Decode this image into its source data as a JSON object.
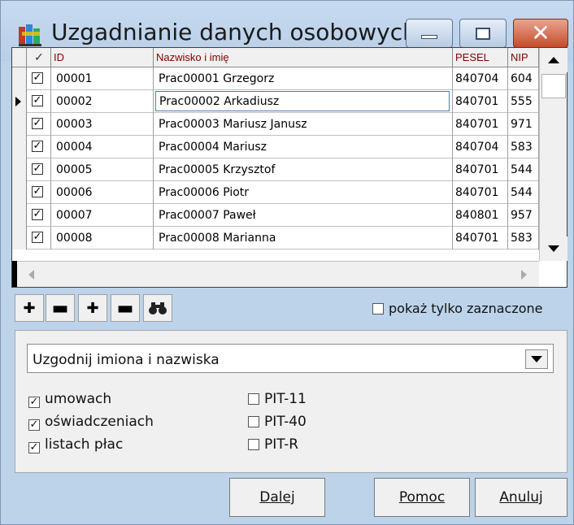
{
  "window": {
    "title": "Uzgadnianie danych osobowych"
  },
  "grid": {
    "columns": [
      "✓",
      "ID",
      "Nazwisko i imię",
      "PESEL",
      "NIP"
    ],
    "selected_row_index": 1,
    "rows": [
      {
        "checked": true,
        "id": "00001",
        "name": "Prac00001 Grzegorz",
        "pesel": "840704",
        "nip": "604"
      },
      {
        "checked": true,
        "id": "00002",
        "name": "Prac00002 Arkadiusz",
        "pesel": "840701",
        "nip": "555"
      },
      {
        "checked": true,
        "id": "00003",
        "name": "Prac00003 Mariusz Janusz",
        "pesel": "840701",
        "nip": "971"
      },
      {
        "checked": true,
        "id": "00004",
        "name": "Prac00004 Mariusz",
        "pesel": "840704",
        "nip": "583"
      },
      {
        "checked": true,
        "id": "00005",
        "name": "Prac00005 Krzysztof",
        "pesel": "840701",
        "nip": "544"
      },
      {
        "checked": true,
        "id": "00006",
        "name": "Prac00006 Piotr",
        "pesel": "840701",
        "nip": "544"
      },
      {
        "checked": true,
        "id": "00007",
        "name": "Prac00007 Paweł",
        "pesel": "840801",
        "nip": "957"
      },
      {
        "checked": true,
        "id": "00008",
        "name": "Prac00008 Marianna",
        "pesel": "840701",
        "nip": "583"
      }
    ]
  },
  "toolbar": {
    "show_checked_only_label": "pokaż tylko zaznaczone"
  },
  "panel": {
    "combo_value": "Uzgodnij imiona i nazwiska",
    "checks_left": [
      {
        "label": "umowach",
        "checked": true
      },
      {
        "label": "oświadczeniach",
        "checked": true
      },
      {
        "label": "listach płac",
        "checked": true
      }
    ],
    "checks_right": [
      {
        "label": "PIT-11",
        "checked": false
      },
      {
        "label": "PIT-40",
        "checked": false
      },
      {
        "label": "PIT-R",
        "checked": false
      }
    ]
  },
  "buttons": {
    "next": "Dalej",
    "help": "Pomoc",
    "cancel": "Anuluj"
  }
}
